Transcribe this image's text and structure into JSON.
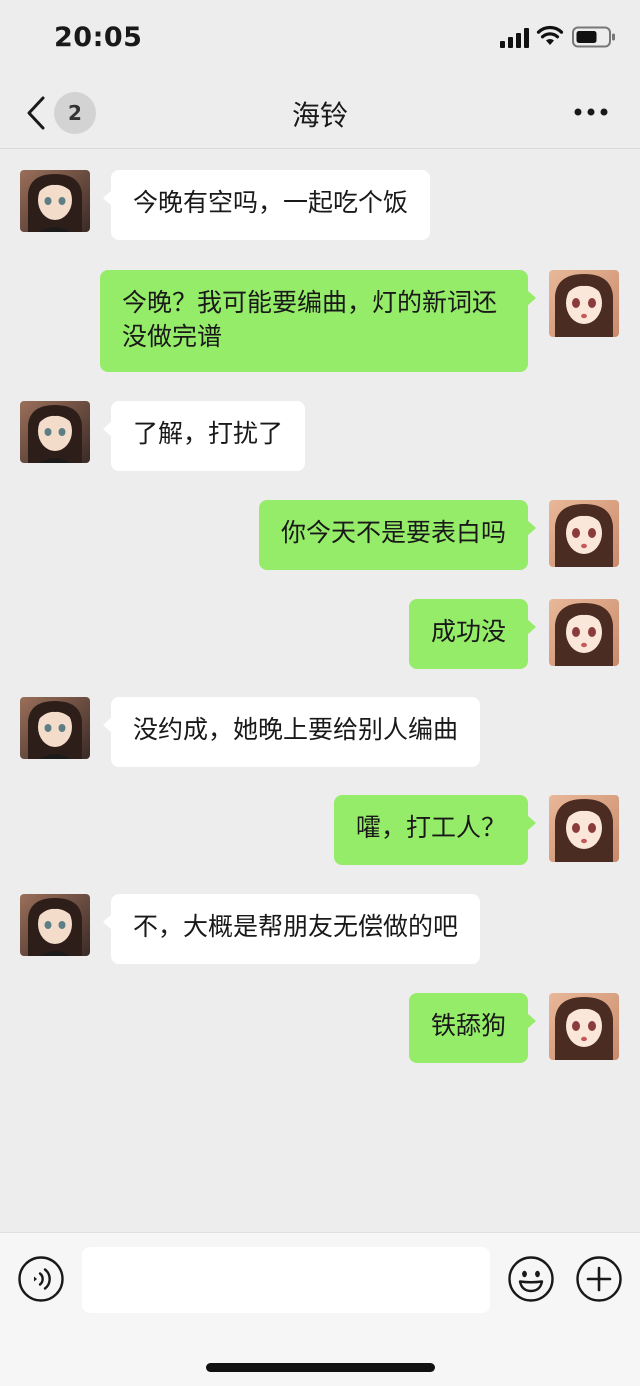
{
  "status_bar": {
    "time": "20:05"
  },
  "header": {
    "back_badge": "2",
    "title": "海铃"
  },
  "messages": [
    {
      "side": "left",
      "text": "今晚有空吗，一起吃个饭"
    },
    {
      "side": "right",
      "text": "今晚？我可能要编曲，灯的新词还没做完谱"
    },
    {
      "side": "left",
      "text": "了解，打扰了"
    },
    {
      "side": "right",
      "text": "你今天不是要表白吗"
    },
    {
      "side": "right",
      "text": "成功没"
    },
    {
      "side": "left",
      "text": "没约成，她晚上要给别人编曲"
    },
    {
      "side": "right",
      "text": "嚯，打工人？"
    },
    {
      "side": "left",
      "text": "不，大概是帮朋友无偿做的吧"
    },
    {
      "side": "right",
      "text": "铁舔狗"
    }
  ],
  "input_bar": {
    "placeholder": "",
    "value": ""
  },
  "icons": {
    "back": "chevron-left-icon",
    "more": "more-icon",
    "voice": "voice-icon",
    "emoji": "emoji-icon",
    "add": "plus-icon"
  },
  "colors": {
    "background": "#ededed",
    "sent_bubble": "#95ec69",
    "received_bubble": "#ffffff"
  }
}
